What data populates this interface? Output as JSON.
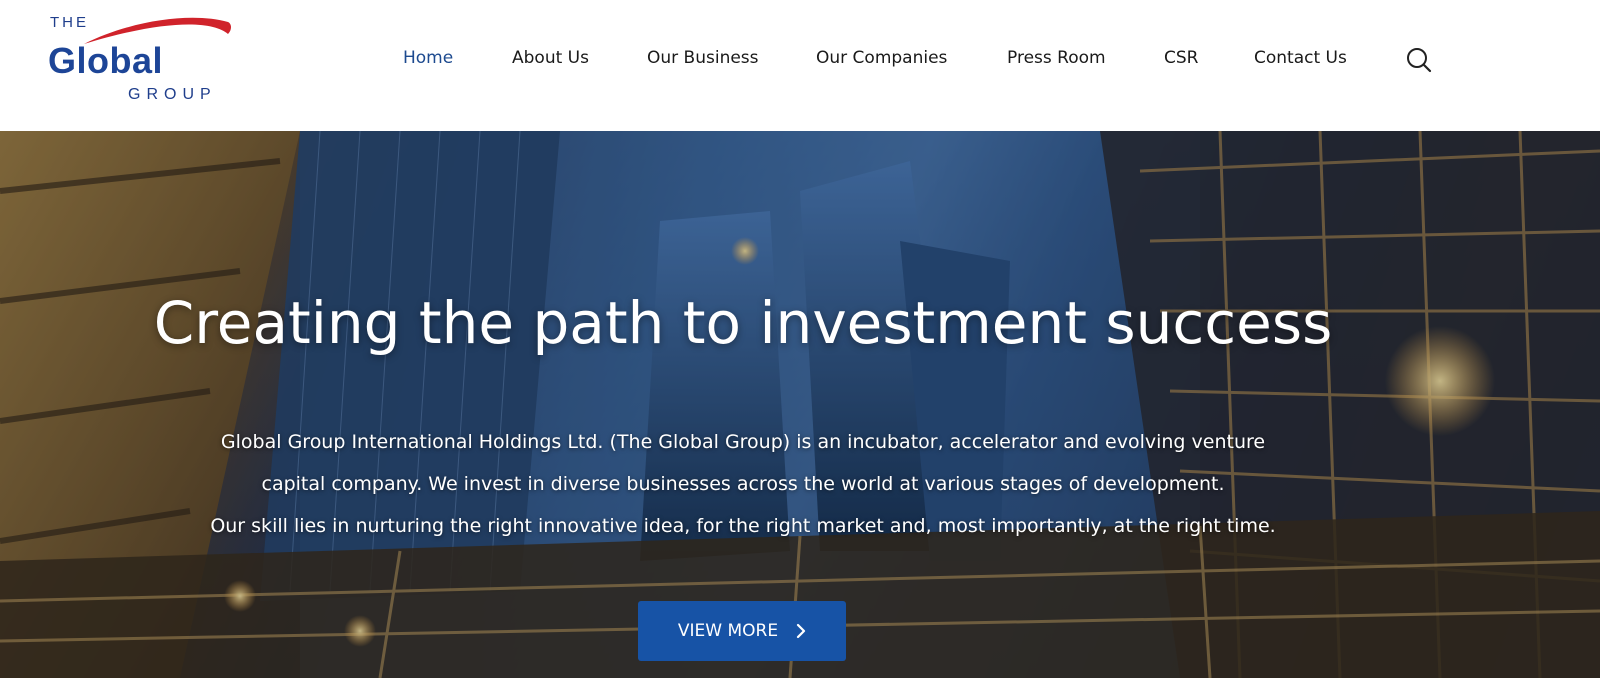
{
  "logo": {
    "the": "THE",
    "main": "Global",
    "group": "GROUP",
    "swoosh_color": "#d0232b",
    "text_color": "#1d4597"
  },
  "nav": {
    "items": [
      {
        "label": "Home",
        "active": true
      },
      {
        "label": "About Us",
        "active": false
      },
      {
        "label": "Our Business",
        "active": false
      },
      {
        "label": "Our Companies",
        "active": false
      },
      {
        "label": "Press Room",
        "active": false
      },
      {
        "label": "CSR",
        "active": false
      },
      {
        "label": "Contact Us",
        "active": false
      }
    ],
    "search_icon": "search-icon",
    "active_color": "#1d4a8f"
  },
  "hero": {
    "title": "Creating the path to investment success",
    "description_lines": [
      "Global Group International Holdings Ltd. (The Global Group) is an incubator, accelerator and evolving venture",
      "capital company. We invest in diverse businesses across the world at various stages of development.",
      "Our skill lies in nurturing the right innovative idea, for the right market and, most importantly, at the right time."
    ],
    "button_label": "VIEW MORE",
    "button_icon": "chevron-right-icon",
    "button_color": "#1753a6"
  }
}
